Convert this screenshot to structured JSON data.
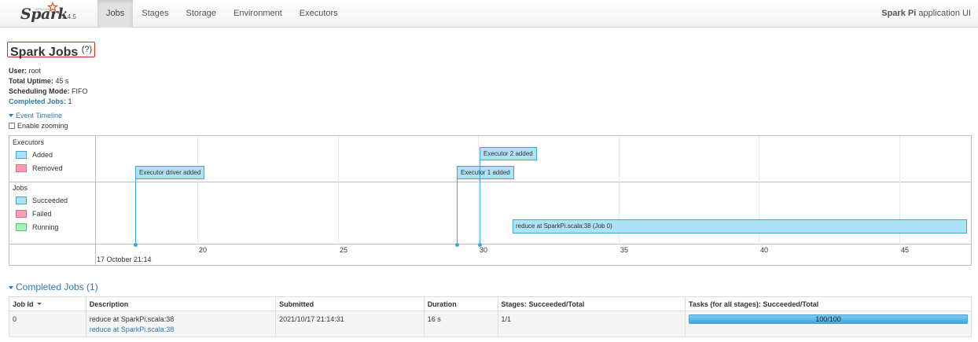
{
  "brand": {
    "apache": "APACHE",
    "name": "Spark",
    "version": "2.4.5"
  },
  "nav": {
    "tabs": [
      "Jobs",
      "Stages",
      "Storage",
      "Environment",
      "Executors"
    ],
    "active": "Jobs"
  },
  "app": {
    "name": "Spark Pi",
    "suffix": " application UI"
  },
  "page": {
    "title": "Spark Jobs",
    "help": "(?)"
  },
  "summary": {
    "user_label": "User:",
    "user": "root",
    "uptime_label": "Total Uptime:",
    "uptime": "45 s",
    "mode_label": "Scheduling Mode:",
    "mode": "FIFO",
    "completed_label": "Completed Jobs:",
    "completed": "1"
  },
  "timeline": {
    "toggle_label": "Event Timeline",
    "zoom_label": "Enable zooming",
    "groups": {
      "executors": "Executors",
      "jobs": "Jobs"
    },
    "executor_legend": [
      "Added",
      "Removed"
    ],
    "job_legend": [
      "Succeeded",
      "Failed",
      "Running"
    ],
    "date_label": "17 October 21:14",
    "ticks": [
      "20",
      "25",
      "30",
      "35",
      "40",
      "45"
    ],
    "events": [
      "Executor driver added",
      "Executor 1 added",
      "Executor 2 added"
    ],
    "job_bar": "reduce at SparkPi.scala:38 (Job 0)",
    "colors": {
      "added": "#aee2f6",
      "removed": "#ff9eb0",
      "running": "#a6f2b0"
    }
  },
  "completed_jobs": {
    "title": "Completed Jobs (1)",
    "headers": [
      "Job Id",
      "Description",
      "Submitted",
      "Duration",
      "Stages: Succeeded/Total",
      "Tasks (for all stages): Succeeded/Total"
    ],
    "rows": [
      {
        "job_id": "0",
        "description": "reduce at SparkPi.scala:38",
        "description_link": "reduce at SparkPi.scala:38",
        "submitted": "2021/10/17 21:14:31",
        "duration": "16 s",
        "stages": "1/1",
        "tasks": "100/100",
        "tasks_progress": 1.0
      }
    ]
  }
}
